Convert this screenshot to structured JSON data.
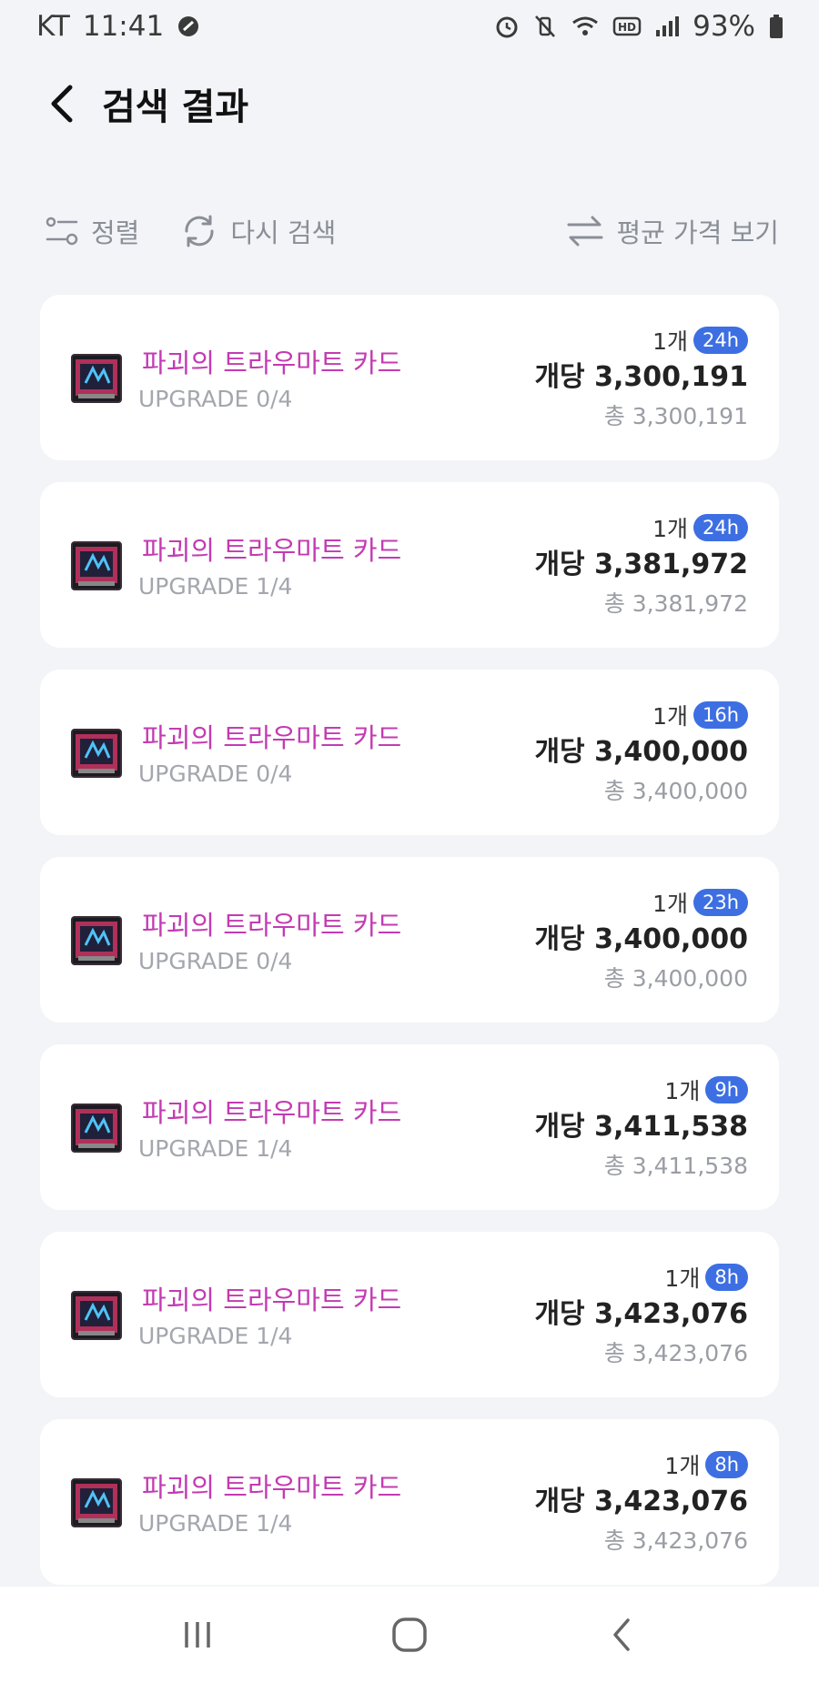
{
  "status_bar": {
    "carrier": "KT",
    "time": "11:41",
    "battery": "93%",
    "icons": [
      "block-icon",
      "alarm-icon",
      "vibrate-icon",
      "wifi-icon",
      "hd-icon",
      "signal-icon",
      "battery-icon"
    ]
  },
  "header": {
    "title": "검색 결과"
  },
  "toolbar": {
    "sort_label": "정렬",
    "research_label": "다시 검색",
    "avg_price_label": "평균 가격 보기"
  },
  "colors": {
    "item_name": "#c33bb2",
    "badge": "#3d6fe3",
    "background": "#f3f4f7"
  },
  "results": [
    {
      "name": "파괴의 트라우마트 카드",
      "upgrade": "UPGRADE 0/4",
      "qty": "1개",
      "time": "24h",
      "unit_price": "개당 3,300,191",
      "total": "총 3,300,191"
    },
    {
      "name": "파괴의 트라우마트 카드",
      "upgrade": "UPGRADE 1/4",
      "qty": "1개",
      "time": "24h",
      "unit_price": "개당 3,381,972",
      "total": "총 3,381,972"
    },
    {
      "name": "파괴의 트라우마트 카드",
      "upgrade": "UPGRADE 0/4",
      "qty": "1개",
      "time": "16h",
      "unit_price": "개당 3,400,000",
      "total": "총 3,400,000"
    },
    {
      "name": "파괴의 트라우마트 카드",
      "upgrade": "UPGRADE 0/4",
      "qty": "1개",
      "time": "23h",
      "unit_price": "개당 3,400,000",
      "total": "총 3,400,000"
    },
    {
      "name": "파괴의 트라우마트 카드",
      "upgrade": "UPGRADE 1/4",
      "qty": "1개",
      "time": "9h",
      "unit_price": "개당 3,411,538",
      "total": "총 3,411,538"
    },
    {
      "name": "파괴의 트라우마트 카드",
      "upgrade": "UPGRADE 1/4",
      "qty": "1개",
      "time": "8h",
      "unit_price": "개당 3,423,076",
      "total": "총 3,423,076"
    },
    {
      "name": "파괴의 트라우마트 카드",
      "upgrade": "UPGRADE 1/4",
      "qty": "1개",
      "time": "8h",
      "unit_price": "개당 3,423,076",
      "total": "총 3,423,076"
    }
  ]
}
